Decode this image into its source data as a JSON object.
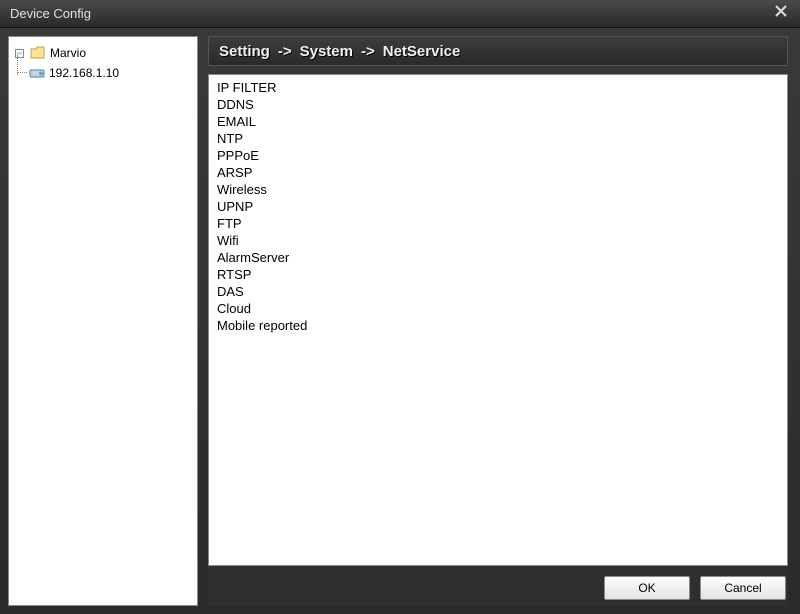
{
  "window": {
    "title": "Device Config"
  },
  "sidebar": {
    "root": {
      "label": "Marvio",
      "expanded": true
    },
    "device": {
      "label": "192.168.1.10"
    }
  },
  "breadcrumb": {
    "seg1": "Setting",
    "seg2": "System",
    "seg3": "NetService",
    "sep": "->"
  },
  "netservice": {
    "items": [
      "IP FILTER",
      "DDNS",
      "EMAIL",
      "NTP",
      "PPPoE",
      "ARSP",
      "Wireless",
      "UPNP",
      "FTP",
      "Wifi",
      "AlarmServer",
      "RTSP",
      "DAS",
      "Cloud",
      "Mobile reported"
    ]
  },
  "buttons": {
    "ok": "OK",
    "cancel": "Cancel"
  }
}
